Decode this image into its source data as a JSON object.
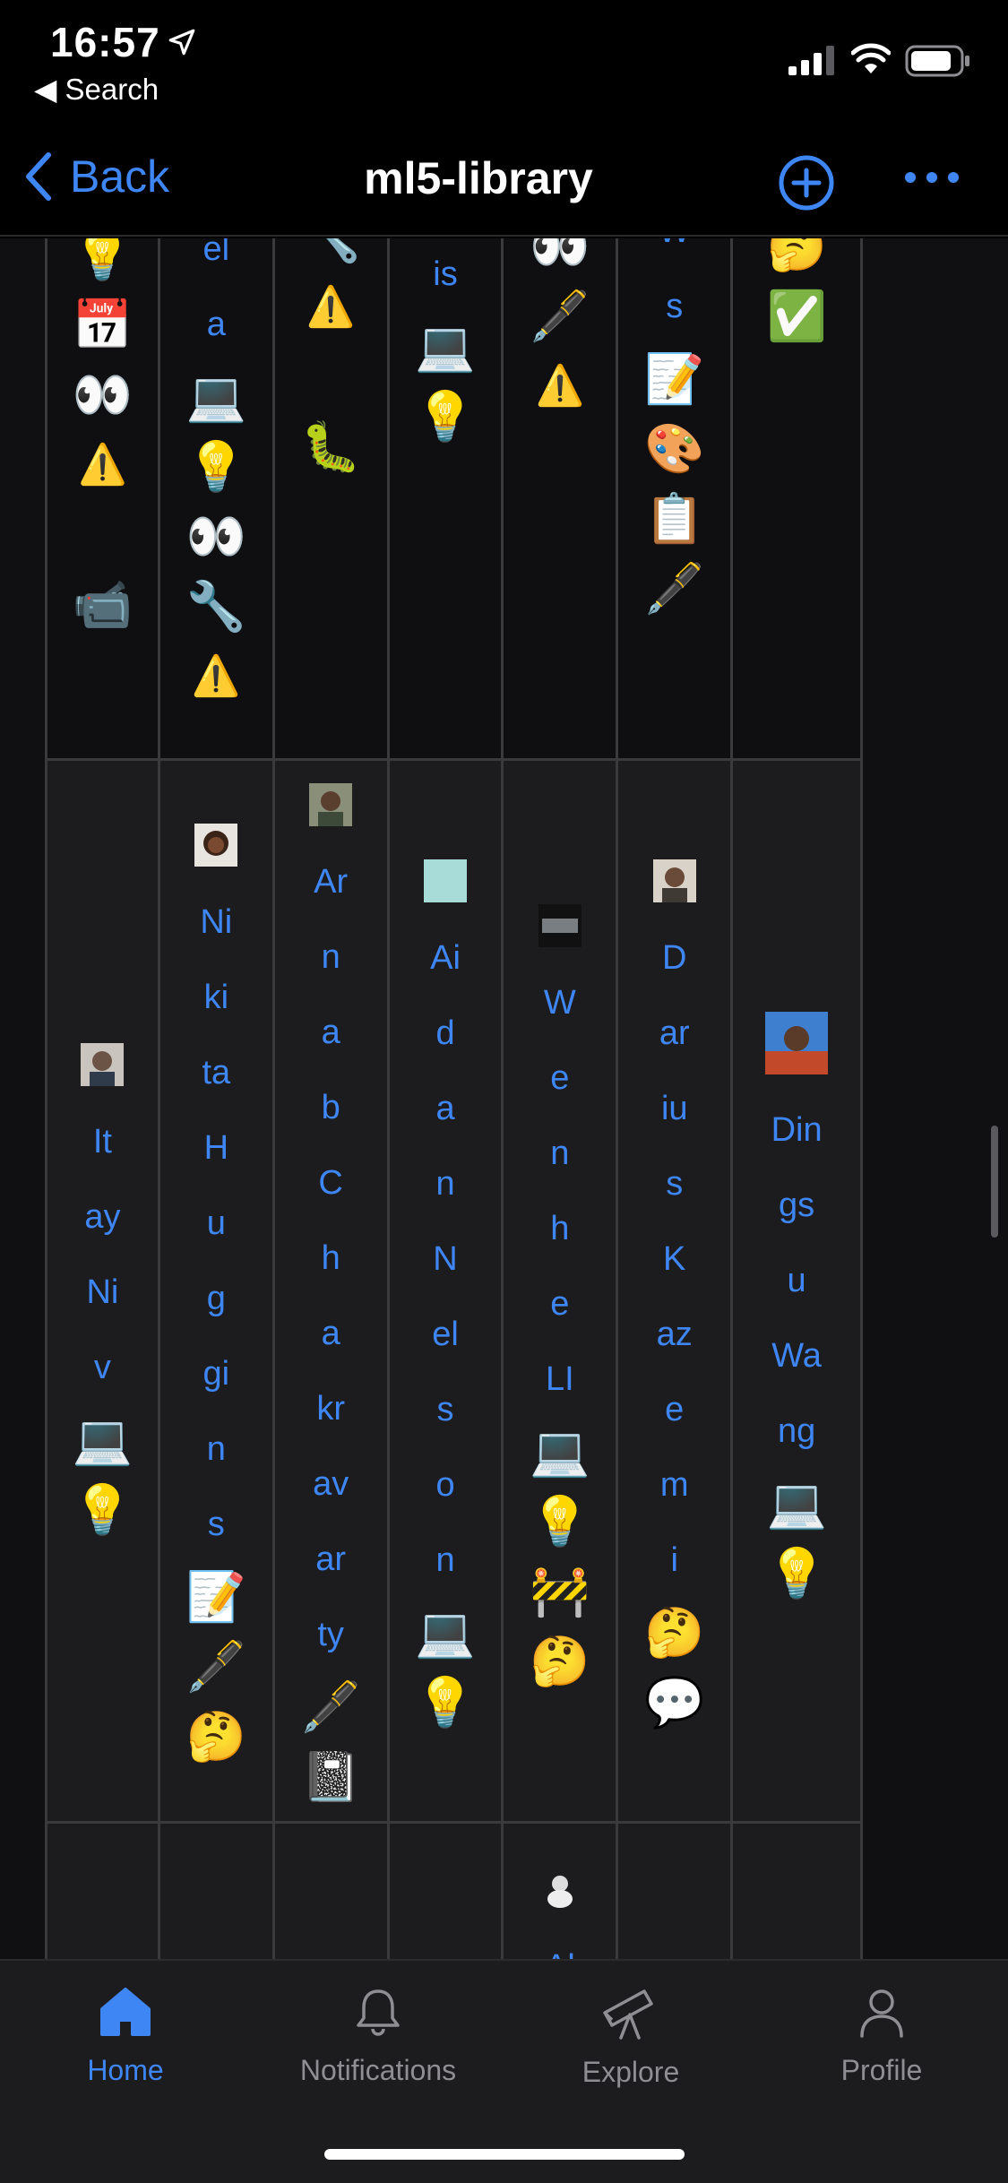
{
  "status_bar": {
    "time": "16:57",
    "back_app": "◀ Search"
  },
  "nav": {
    "back_label": "Back",
    "title": "ml5-library"
  },
  "grid": {
    "top_row_cells": [
      {
        "items": [
          "💡",
          "📅",
          "👀",
          "⚠️",
          "",
          "📹"
        ]
      },
      {
        "items": [
          "el",
          "a",
          "💻",
          "💡",
          "👀",
          "🔧",
          "⚠️"
        ]
      },
      {
        "items": [
          "🔧",
          "⚠️",
          "",
          "🐛"
        ]
      },
      {
        "items": [
          "is",
          "💻",
          "💡"
        ]
      },
      {
        "items": [
          "👀",
          "🖋️",
          "⚠️"
        ]
      },
      {
        "items": [
          "W",
          "s",
          "📝",
          "🎨",
          "📋",
          "🖋️"
        ]
      },
      {
        "items": [
          "🤔",
          "✅"
        ]
      }
    ],
    "contributors": [
      {
        "name_parts": [
          "It",
          "ay",
          "Ni",
          "v"
        ],
        "emojis": [
          "💻",
          "💡"
        ]
      },
      {
        "name_parts": [
          "Ni",
          "ki",
          "ta",
          "H",
          "u",
          "g",
          "gi",
          "n",
          "s"
        ],
        "emojis": [
          "📝",
          "🖋️",
          "🤔"
        ]
      },
      {
        "name_parts": [
          "Ar",
          "n",
          "a",
          "b",
          "C",
          "h",
          "a",
          "kr",
          "av",
          "ar",
          "ty"
        ],
        "emojis": [
          "🖋️",
          "📓"
        ]
      },
      {
        "name_parts": [
          "Ai",
          "d",
          "a",
          "n",
          "N",
          "el",
          "s",
          "o",
          "n"
        ],
        "emojis": [
          "💻",
          "💡"
        ]
      },
      {
        "name_parts": [
          "W",
          "e",
          "n",
          "h",
          "e",
          "LI"
        ],
        "emojis": [
          "💻",
          "💡",
          "🚧",
          "🤔"
        ]
      },
      {
        "name_parts": [
          "D",
          "ar",
          "iu",
          "s",
          "K",
          "az",
          "e",
          "m",
          "i"
        ],
        "emojis": [
          "🤔",
          "💬"
        ]
      },
      {
        "name_parts": [
          "Din",
          "gs",
          "u",
          "Wa",
          "ng"
        ],
        "emojis": [
          "💻",
          "💡"
        ]
      }
    ],
    "bottom_row_partial": {
      "name_start": "Al"
    }
  },
  "tabs": [
    {
      "label": "Home",
      "icon": "home-icon",
      "active": true
    },
    {
      "label": "Notifications",
      "icon": "bell-icon",
      "active": false
    },
    {
      "label": "Explore",
      "icon": "telescope-icon",
      "active": false
    },
    {
      "label": "Profile",
      "icon": "person-icon",
      "active": false
    }
  ],
  "colors": {
    "accent": "#3f86f5",
    "background": "#000000",
    "cell": "#1c1c1e",
    "border": "#3a3a3c"
  }
}
